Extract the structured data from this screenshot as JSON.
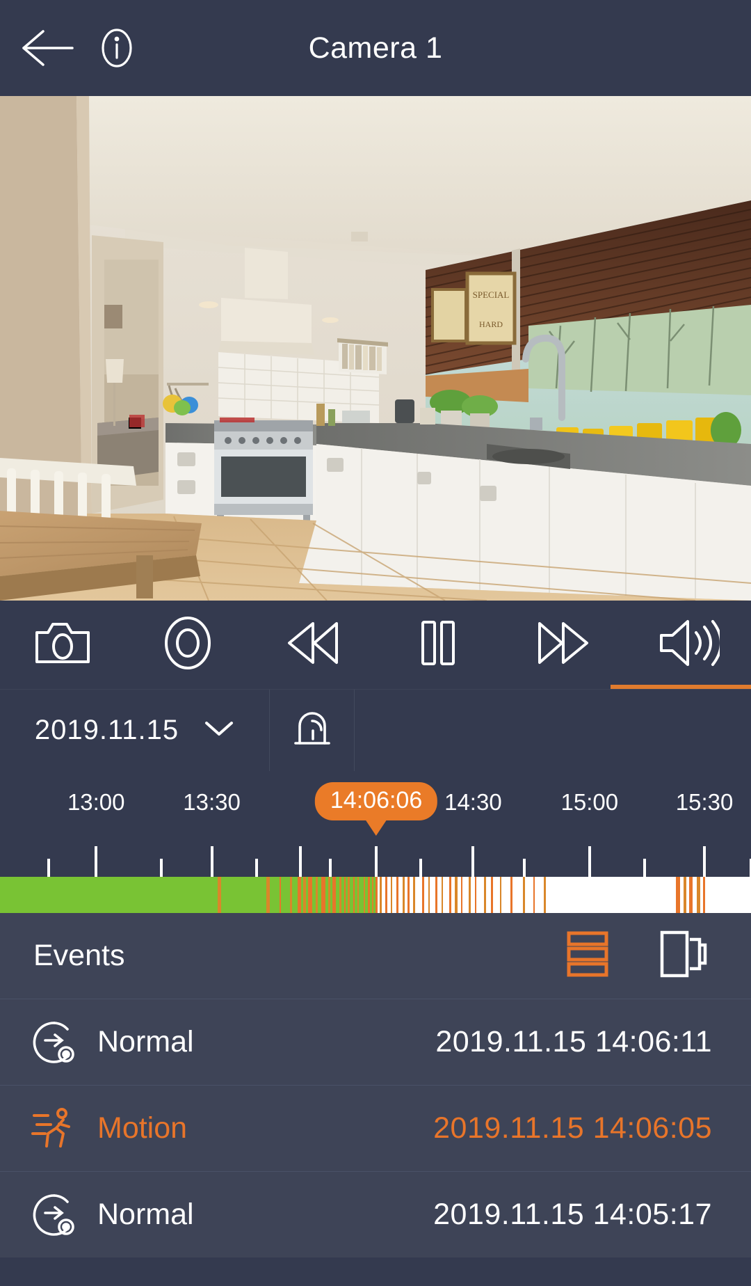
{
  "header": {
    "title": "Camera 1",
    "back_icon": "arrow-left-icon",
    "info_icon": "info-circle-icon"
  },
  "controls": {
    "items": [
      {
        "name": "snapshot",
        "icon": "camera-icon",
        "active": false
      },
      {
        "name": "record",
        "icon": "record-circle-icon",
        "active": false
      },
      {
        "name": "rewind",
        "icon": "rewind-icon",
        "active": false
      },
      {
        "name": "pause",
        "icon": "pause-icon",
        "active": false
      },
      {
        "name": "forward",
        "icon": "fast-forward-icon",
        "active": false
      },
      {
        "name": "audio",
        "icon": "speaker-volume-icon",
        "active": true
      }
    ],
    "active_accent": "#e07b2e"
  },
  "datebar": {
    "date": "2019.11.15",
    "chevron_icon": "chevron-down-icon",
    "alarm_icon": "alarm-bell-icon"
  },
  "timeline": {
    "current_time_badge": "14:06:06",
    "badge_color": "#ea7b28",
    "badge_position_pct": 50.1,
    "labels": [
      {
        "text": "13:00",
        "pos_pct": 12.8
      },
      {
        "text": "13:30",
        "pos_pct": 28.2
      },
      {
        "text": "14:30",
        "pos_pct": 63.0
      },
      {
        "text": "15:00",
        "pos_pct": 78.5
      },
      {
        "text": "15:30",
        "pos_pct": 93.8
      }
    ],
    "major_ticks_pct": [
      12.8,
      28.2,
      40.0,
      50.1,
      63.0,
      78.5,
      93.8
    ],
    "minor_ticks_pct": [
      6.5,
      21.5,
      34.2,
      44.0,
      56.0,
      69.8,
      85.8,
      100.0
    ],
    "recorded_color": "#79c334",
    "motion_color": "#e8752a",
    "event_color_alt": "#d9872a",
    "empty_color": "#ffffff",
    "recorded_end_pct": 50.2,
    "motion_marks": [
      {
        "x": 29.0,
        "w": 0.45,
        "c": "#d9872a"
      },
      {
        "x": 35.5,
        "w": 0.4,
        "c": "#d9872a"
      },
      {
        "x": 39.6,
        "w": 0.45,
        "c": "#e8752a"
      },
      {
        "x": 40.4,
        "w": 0.3,
        "c": "#d9872a"
      },
      {
        "x": 41.0,
        "w": 0.55,
        "c": "#e8752a"
      },
      {
        "x": 42.0,
        "w": 0.35,
        "c": "#d9872a"
      },
      {
        "x": 42.8,
        "w": 0.5,
        "c": "#e8752a"
      },
      {
        "x": 43.7,
        "w": 0.3,
        "c": "#d9872a"
      },
      {
        "x": 44.3,
        "w": 0.45,
        "c": "#e8752a"
      },
      {
        "x": 45.2,
        "w": 0.25,
        "c": "#d9872a"
      },
      {
        "x": 46.3,
        "w": 0.3,
        "c": "#d9872a"
      },
      {
        "x": 47.0,
        "w": 0.25,
        "c": "#e8752a"
      },
      {
        "x": 47.6,
        "w": 0.2,
        "c": "#d9872a"
      },
      {
        "x": 48.4,
        "w": 0.25,
        "c": "#d9872a"
      },
      {
        "x": 49.0,
        "w": 0.3,
        "c": "#e8752a"
      },
      {
        "x": 49.5,
        "w": 0.2,
        "c": "#d9872a"
      },
      {
        "x": 50.0,
        "w": 0.25,
        "c": "#e8752a"
      },
      {
        "x": 50.6,
        "w": 0.2,
        "c": "#d9872a"
      },
      {
        "x": 51.3,
        "w": 0.3,
        "c": "#e8752a"
      },
      {
        "x": 52.0,
        "w": 0.25,
        "c": "#d9872a"
      },
      {
        "x": 52.8,
        "w": 0.3,
        "c": "#e8752a"
      },
      {
        "x": 53.6,
        "w": 0.25,
        "c": "#d9872a"
      },
      {
        "x": 54.3,
        "w": 0.2,
        "c": "#e8752a"
      },
      {
        "x": 55.0,
        "w": 0.25,
        "c": "#d9872a"
      },
      {
        "x": 56.2,
        "w": 0.3,
        "c": "#e8752a"
      },
      {
        "x": 57.0,
        "w": 0.2,
        "c": "#d9872a"
      },
      {
        "x": 58.0,
        "w": 0.25,
        "c": "#e8752a"
      },
      {
        "x": 58.8,
        "w": 0.2,
        "c": "#d9872a"
      },
      {
        "x": 59.8,
        "w": 0.25,
        "c": "#e8752a"
      },
      {
        "x": 60.6,
        "w": 0.3,
        "c": "#d9872a"
      },
      {
        "x": 61.4,
        "w": 0.2,
        "c": "#e8752a"
      },
      {
        "x": 62.4,
        "w": 0.25,
        "c": "#d9872a"
      },
      {
        "x": 63.2,
        "w": 0.2,
        "c": "#e8752a"
      },
      {
        "x": 64.4,
        "w": 0.3,
        "c": "#d9872a"
      },
      {
        "x": 65.4,
        "w": 0.25,
        "c": "#e8752a"
      },
      {
        "x": 66.6,
        "w": 0.2,
        "c": "#d9872a"
      },
      {
        "x": 68.0,
        "w": 0.25,
        "c": "#e8752a"
      },
      {
        "x": 69.6,
        "w": 0.3,
        "c": "#d9872a"
      },
      {
        "x": 71.0,
        "w": 0.2,
        "c": "#e8752a"
      },
      {
        "x": 72.4,
        "w": 0.25,
        "c": "#d9872a"
      },
      {
        "x": 45.8,
        "w": 0.2,
        "c": "#e8752a"
      },
      {
        "x": 38.6,
        "w": 0.25,
        "c": "#d9872a"
      },
      {
        "x": 37.2,
        "w": 0.2,
        "c": "#e8752a"
      },
      {
        "x": 90.0,
        "w": 0.6,
        "c": "#e8752a"
      },
      {
        "x": 91.0,
        "w": 0.35,
        "c": "#d9872a"
      },
      {
        "x": 91.8,
        "w": 0.45,
        "c": "#e8752a"
      },
      {
        "x": 92.8,
        "w": 0.4,
        "c": "#d9872a"
      },
      {
        "x": 93.6,
        "w": 0.3,
        "c": "#e8752a"
      }
    ]
  },
  "events": {
    "title": "Events",
    "list_view_icon": "list-view-icon",
    "card_view_icon": "card-view-icon",
    "active_view": "list",
    "rows": [
      {
        "type": "Normal",
        "icon": "continuous-record-icon",
        "timestamp": "2019.11.15 14:06:11",
        "highlight": false
      },
      {
        "type": "Motion",
        "icon": "motion-running-icon",
        "timestamp": "2019.11.15 14:06:05",
        "highlight": true
      },
      {
        "type": "Normal",
        "icon": "continuous-record-icon",
        "timestamp": "2019.11.15 14:05:17",
        "highlight": false
      }
    ]
  }
}
